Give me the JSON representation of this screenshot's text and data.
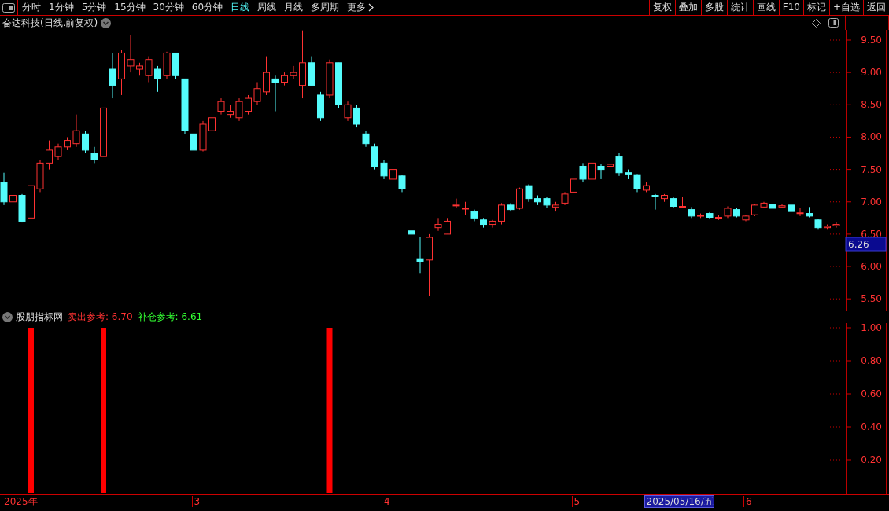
{
  "toolbar": {
    "periods": [
      {
        "label": "分时",
        "selected": false
      },
      {
        "label": "1分钟",
        "selected": false
      },
      {
        "label": "5分钟",
        "selected": false
      },
      {
        "label": "15分钟",
        "selected": false
      },
      {
        "label": "30分钟",
        "selected": false
      },
      {
        "label": "60分钟",
        "selected": false
      },
      {
        "label": "日线",
        "selected": true
      },
      {
        "label": "周线",
        "selected": false
      },
      {
        "label": "月线",
        "selected": false
      },
      {
        "label": "多周期",
        "selected": false
      }
    ],
    "more": "更多",
    "actions": [
      "复权",
      "叠加",
      "多股",
      "统计",
      "画线",
      "F10",
      "标记",
      "+自选",
      "返回"
    ]
  },
  "price_pane": {
    "title": "奋达科技(日线.前复权)",
    "axis_labels": [
      "9.50",
      "9.00",
      "8.50",
      "8.00",
      "7.50",
      "7.00",
      "6.50",
      "6.00",
      "5.50"
    ],
    "cursor_price": "6.26"
  },
  "indicator_pane": {
    "name": "股朋指标网",
    "readouts": [
      {
        "label": "卖出参考: 6.70",
        "color": "#ff3232"
      },
      {
        "label": "补仓参考: 6.61",
        "color": "#33ff33"
      }
    ],
    "axis_labels": [
      "1.00",
      "0.80",
      "0.60",
      "0.40",
      "0.20"
    ]
  },
  "time_axis": [
    {
      "label": "2025年",
      "kind": "period"
    },
    {
      "label": "3",
      "kind": "period"
    },
    {
      "label": "4",
      "kind": "period"
    },
    {
      "label": "5",
      "kind": "period"
    },
    {
      "label": "2025/05/16/五",
      "kind": "cursor"
    },
    {
      "label": "6",
      "kind": "period"
    }
  ]
}
